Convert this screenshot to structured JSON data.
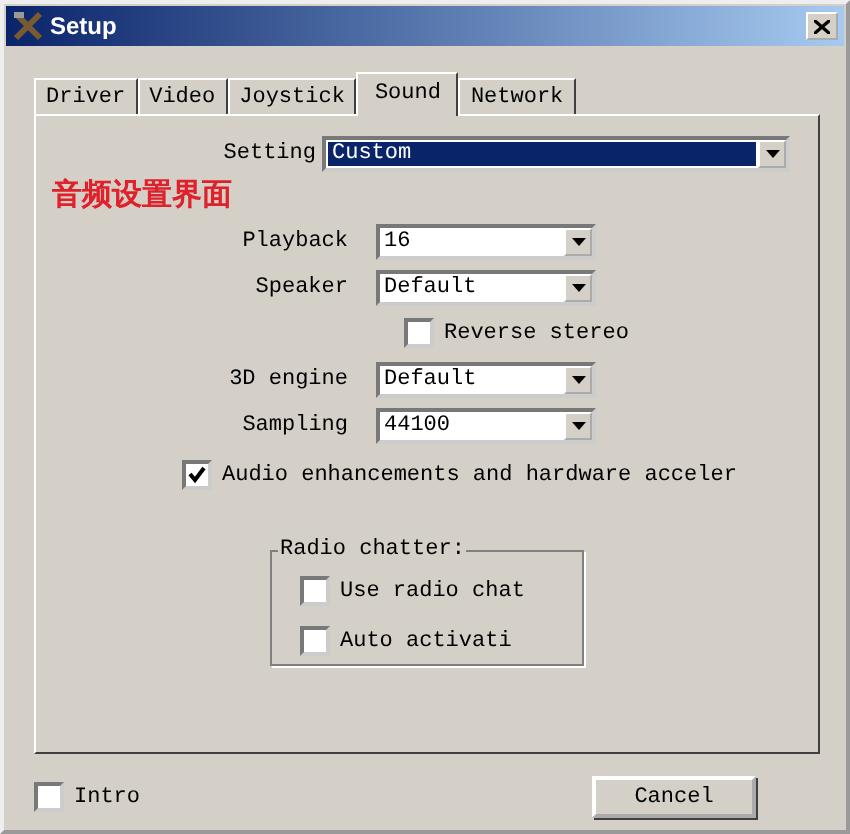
{
  "window": {
    "title": "Setup"
  },
  "tabs": [
    {
      "label": "Driver",
      "selected": false
    },
    {
      "label": "Video",
      "selected": false
    },
    {
      "label": "Joystick",
      "selected": false
    },
    {
      "label": "Sound",
      "selected": true
    },
    {
      "label": "Network",
      "selected": false
    }
  ],
  "setting": {
    "label": "Setting",
    "value": "Custom"
  },
  "annotation": "音频设置界面",
  "rows": [
    {
      "kind": "select",
      "label": "Playback",
      "value": "16"
    },
    {
      "kind": "select",
      "label": "Speaker",
      "value": "Default"
    },
    {
      "kind": "check",
      "label": "Reverse stereo",
      "checked": false
    },
    {
      "kind": "select",
      "label": "3D engine",
      "value": "Default"
    },
    {
      "kind": "select",
      "label": "Sampling",
      "value": "44100"
    }
  ],
  "enhancements": {
    "label": "Audio enhancements and hardware acceler",
    "checked": true
  },
  "radio_chatter": {
    "title": "Radio chatter:",
    "options": [
      {
        "label": "Use radio chat",
        "checked": false
      },
      {
        "label": "Auto activati",
        "checked": false
      }
    ]
  },
  "intro": {
    "label": "Intro",
    "checked": false
  },
  "buttons": [
    "Cancel"
  ]
}
